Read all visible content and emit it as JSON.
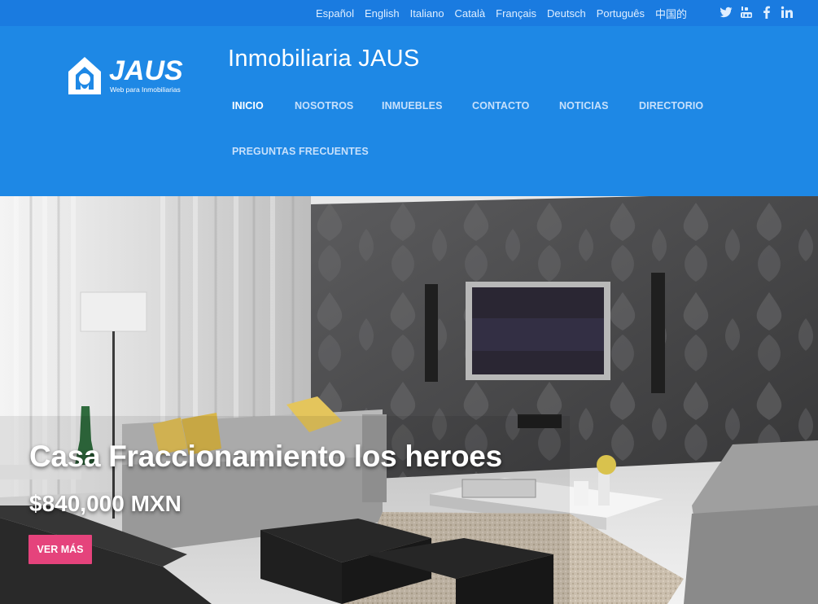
{
  "languages": [
    "Español",
    "English",
    "Italiano",
    "Català",
    "Français",
    "Deutsch",
    "Português",
    "中国的"
  ],
  "social": [
    {
      "name": "twitter-icon"
    },
    {
      "name": "youtube-icon"
    },
    {
      "name": "facebook-icon"
    },
    {
      "name": "linkedin-icon"
    }
  ],
  "logo": {
    "brand": "JAUS",
    "tagline": "Web para Inmobiliarias"
  },
  "site_title": "Inmobiliaria JAUS",
  "nav": {
    "inicio": "INICIO",
    "nosotros": "NOSOTROS",
    "inmuebles": "INMUEBLES",
    "contacto": "CONTACTO",
    "noticias": "NOTICIAS",
    "directorio": "DIRECTORIO",
    "faq": "PREGUNTAS FRECUENTES",
    "active": "INICIO"
  },
  "hero": {
    "title": "Casa Fraccionamiento los heroes",
    "price": "$840,000 MXN",
    "button": "VER MÁS"
  },
  "colors": {
    "topbar": "#1a7be0",
    "header": "#1e88e5",
    "accent_button": "#e5437c"
  }
}
